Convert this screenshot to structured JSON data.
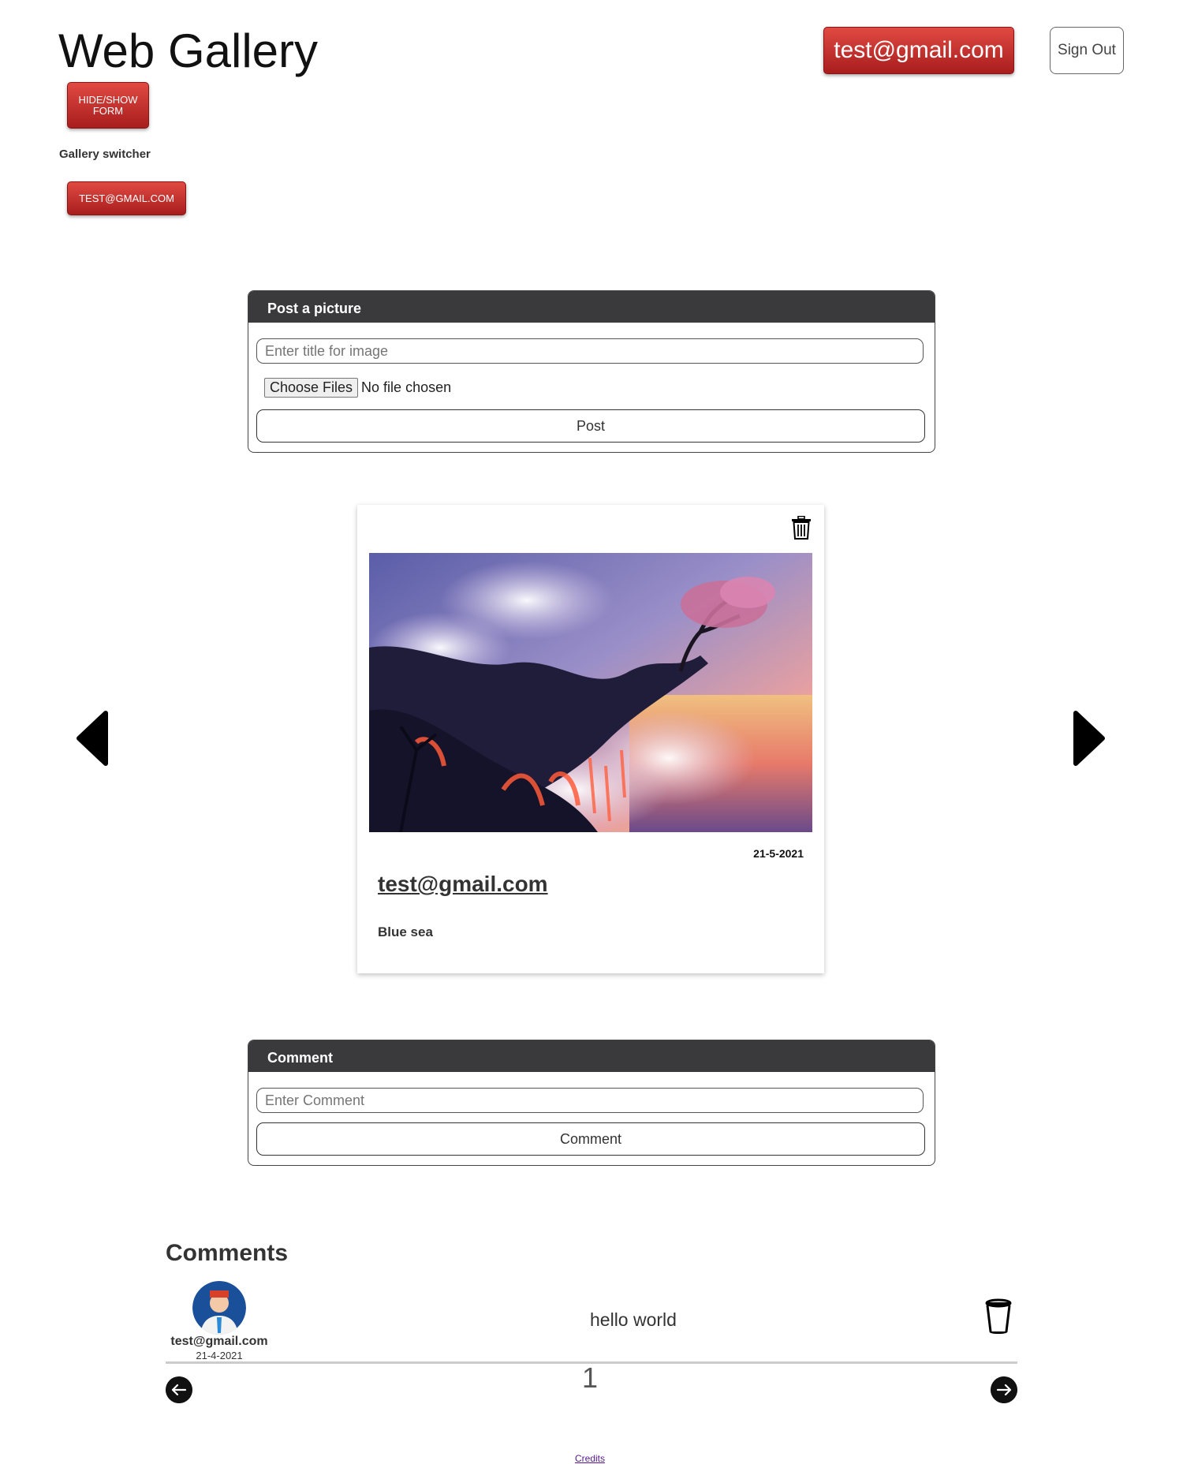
{
  "header": {
    "title": "Web Gallery",
    "user_button": "test@gmail.com",
    "signout_button": "Sign Out",
    "hide_show_button": "HIDE/SHOW FORM",
    "gallery_switcher_label": "Gallery switcher",
    "gallery_buttons": [
      "TEST@GMAIL.COM"
    ]
  },
  "post_form": {
    "heading": "Post a picture",
    "title_placeholder": "Enter title for image",
    "choose_files": "Choose Files",
    "file_status": "No file chosen",
    "submit": "Post"
  },
  "image_card": {
    "date": "21-5-2021",
    "author": "test@gmail.com",
    "title": "Blue sea"
  },
  "comment_form": {
    "heading": "Comment",
    "placeholder": "Enter Comment",
    "submit": "Comment"
  },
  "comments": {
    "heading": "Comments",
    "items": [
      {
        "author": "test@gmail.com",
        "date": "21-4-2021",
        "text": "hello world"
      }
    ],
    "page": "1"
  },
  "footer": {
    "credits": "Credits"
  },
  "icons": {
    "trash": "trash-icon",
    "prev": "triangle-left-icon",
    "next": "triangle-right-icon",
    "avatar": "user-avatar-icon",
    "comment_trash": "cup-trash-icon",
    "page_prev": "arrow-left-circle-icon",
    "page_next": "arrow-right-circle-icon"
  },
  "colors": {
    "accent_red": "#c0302a",
    "panel_header": "#3a3a3d",
    "link": "#551a8b"
  }
}
